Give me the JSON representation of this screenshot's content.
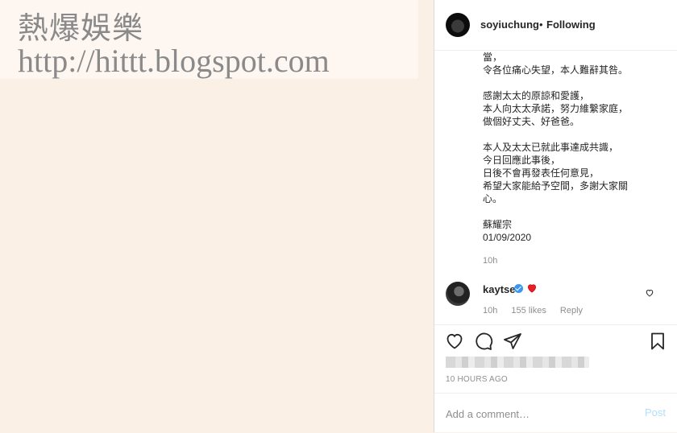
{
  "watermark": {
    "line1": "熱爆娛樂",
    "line2": "http://hittt.blogspot.com"
  },
  "post": {
    "username": "soyiuchung",
    "separator": "•",
    "follow_status": "Following",
    "caption_paragraphs": [
      [
        "當，",
        "令各位痛心失望，本人難辭其咎。"
      ],
      [
        "感謝太太的原諒和愛護，",
        "本人向太太承諾，努力維繫家庭，",
        "做個好丈夫、好爸爸。"
      ],
      [
        "本人及太太已就此事達成共識，",
        "今日回應此事後，",
        "日後不會再發表任何意見，",
        "希望大家能給予空間，多謝大家關",
        "心。"
      ],
      [
        "蘇耀宗",
        "01/09/2020"
      ]
    ],
    "caption_time": "10h"
  },
  "comment": {
    "username": "kaytse",
    "time": "10h",
    "likes": "155 likes",
    "reply_label": "Reply"
  },
  "footer": {
    "time_ago": "10 HOURS AGO",
    "comment_placeholder": "Add a comment…",
    "post_label": "Post"
  },
  "colors": {
    "left_background": "#fbf0e6",
    "link_blue": "#b2dffc",
    "verified_blue": "#3897f0",
    "heart_red": "#ed1c24"
  },
  "icons": [
    "heart-icon",
    "comment-icon",
    "share-icon",
    "bookmark-icon",
    "verified-badge-icon",
    "red-heart-emoji-icon",
    "comment-like-heart-icon"
  ]
}
